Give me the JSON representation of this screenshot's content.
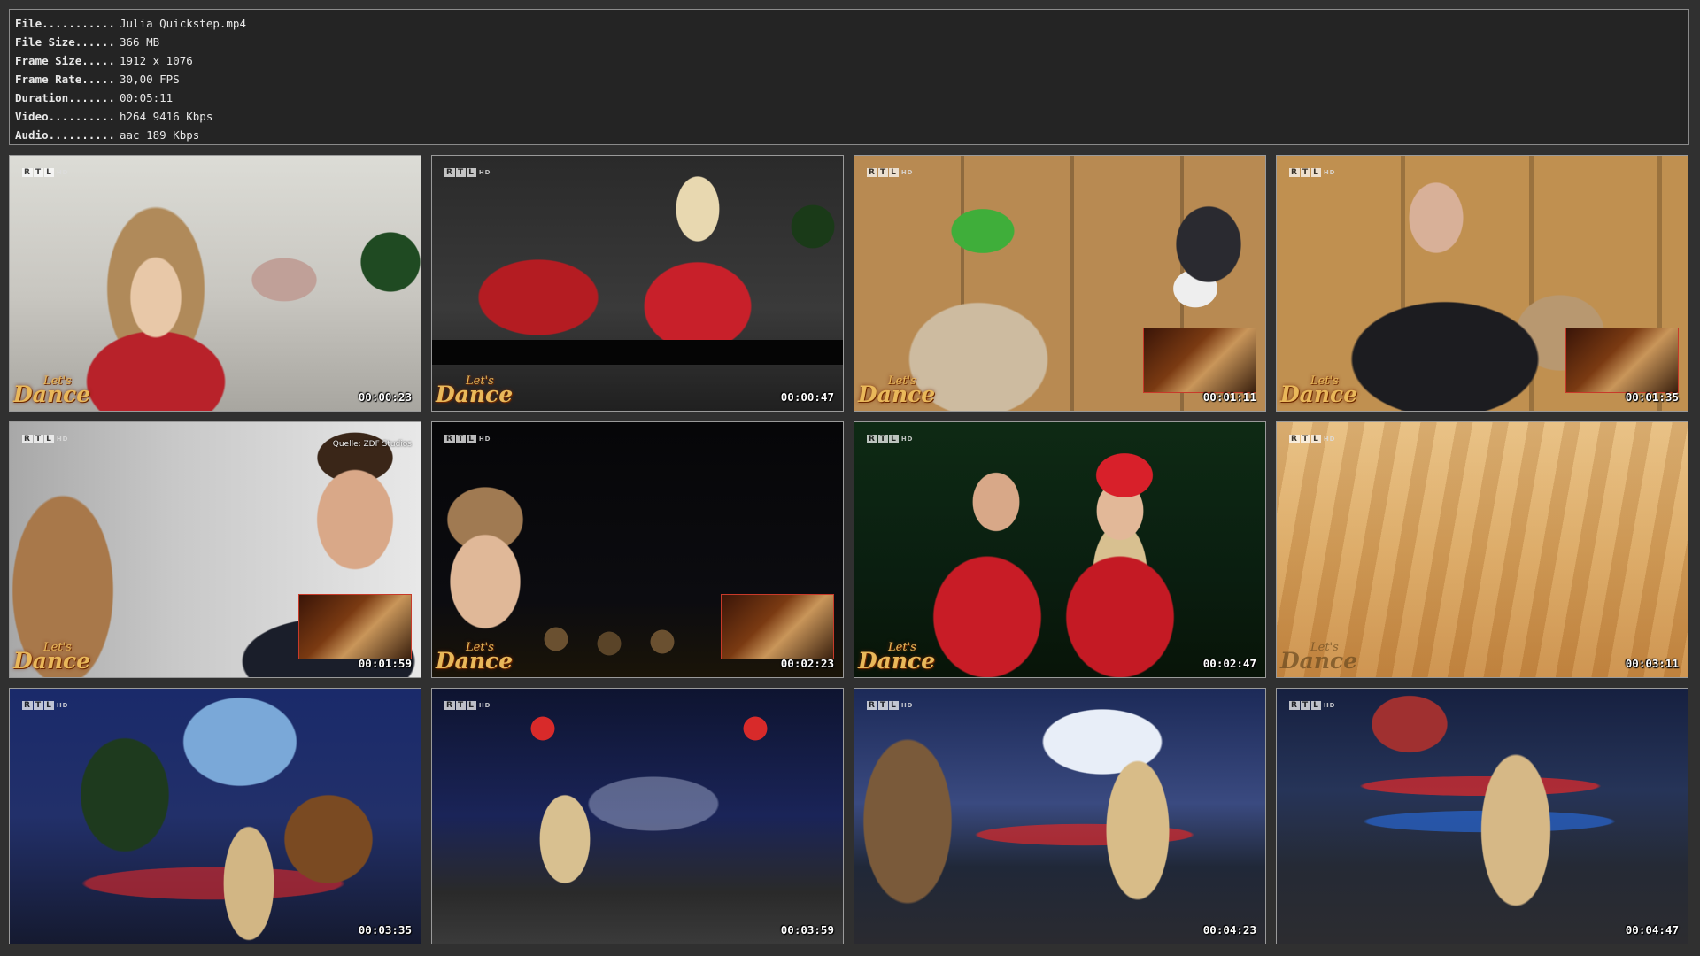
{
  "info": [
    {
      "key": "File...........",
      "value": "Julia Quickstep.mp4"
    },
    {
      "key": "File Size......",
      "value": "366 MB"
    },
    {
      "key": "Frame Size.....",
      "value": "1912 x 1076"
    },
    {
      "key": "Frame Rate.....",
      "value": "30,00 FPS"
    },
    {
      "key": "Duration.......",
      "value": "00:05:11"
    },
    {
      "key": "Video..........",
      "value": "h264 9416 Kbps"
    },
    {
      "key": "Audio..........",
      "value": "aac 189 Kbps"
    }
  ],
  "overlay": {
    "channel_letters": [
      "R",
      "T",
      "L"
    ],
    "channel_suffix": "HD",
    "logo_line1": "Let's",
    "logo_line2": "Dance",
    "source_credit": "Quelle: ZDF Studios"
  },
  "thumbnails": [
    {
      "timestamp": "00:00:23"
    },
    {
      "timestamp": "00:00:47"
    },
    {
      "timestamp": "00:01:11"
    },
    {
      "timestamp": "00:01:35"
    },
    {
      "timestamp": "00:01:59"
    },
    {
      "timestamp": "00:02:23"
    },
    {
      "timestamp": "00:02:47"
    },
    {
      "timestamp": "00:03:11"
    },
    {
      "timestamp": "00:03:35"
    },
    {
      "timestamp": "00:03:59"
    },
    {
      "timestamp": "00:04:23"
    },
    {
      "timestamp": "00:04:47"
    }
  ]
}
